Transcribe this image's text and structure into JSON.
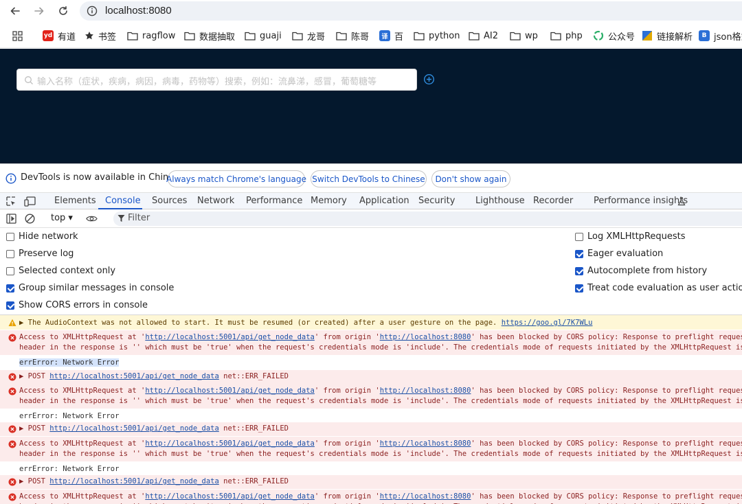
{
  "browser": {
    "url": "localhost:8080",
    "bookmarks": [
      {
        "label": "有道",
        "icon": "youdao-icon",
        "badge": "yd",
        "color": "#e2231a"
      },
      {
        "label": "书签",
        "icon": "star-icon"
      },
      {
        "label": "ragflow",
        "icon": "folder-icon"
      },
      {
        "label": "数据抽取",
        "icon": "folder-icon"
      },
      {
        "label": "guaji",
        "icon": "folder-icon"
      },
      {
        "label": "龙哥",
        "icon": "folder-icon"
      },
      {
        "label": "陈哥",
        "icon": "folder-icon"
      },
      {
        "label": "百",
        "icon": "translate-icon",
        "badge": "译",
        "color": "#2b6fd6"
      },
      {
        "label": "python",
        "icon": "folder-icon"
      },
      {
        "label": "AI2",
        "icon": "folder-icon"
      },
      {
        "label": "wp",
        "icon": "folder-icon"
      },
      {
        "label": "php",
        "icon": "folder-icon"
      },
      {
        "label": "公众号",
        "icon": "wechat-mp-icon",
        "color": "#2aae67"
      },
      {
        "label": "链接解析",
        "icon": "link-parse-icon",
        "color": "#e0a800"
      },
      {
        "label": "json格式",
        "icon": "json-icon",
        "badge": "B",
        "color": "#2b6fd6"
      }
    ]
  },
  "app": {
    "search_placeholder": "输入名称（症状，疾病，病因，病毒，药物等）搜索，例如：流鼻涕，感冒，葡萄糖等",
    "background": "#04182d"
  },
  "devtools": {
    "infobar": {
      "text": "DevTools is now available in Chinese!",
      "buttons": [
        "Always match Chrome's language",
        "Switch DevTools to Chinese",
        "Don't show again"
      ]
    },
    "tabs": [
      "Elements",
      "Console",
      "Sources",
      "Network",
      "Performance",
      "Memory",
      "Application",
      "Security",
      "Lighthouse",
      "Recorder",
      "Performance insights"
    ],
    "active_tab": "Console",
    "toolbar": {
      "context": "top ▾",
      "filter": "Filter"
    },
    "settings_left": [
      {
        "label": "Hide network",
        "checked": false
      },
      {
        "label": "Preserve log",
        "checked": false
      },
      {
        "label": "Selected context only",
        "checked": false
      },
      {
        "label": "Group similar messages in console",
        "checked": true
      },
      {
        "label": "Show CORS errors in console",
        "checked": true
      }
    ],
    "settings_right": [
      {
        "label": "Log XMLHttpRequests",
        "checked": false
      },
      {
        "label": "Eager evaluation",
        "checked": true
      },
      {
        "label": "Autocomplete from history",
        "checked": true
      },
      {
        "label": "Treat code evaluation as user action",
        "checked": true
      }
    ],
    "console": {
      "warning": {
        "text": "▶ The AudioContext was not allowed to start. It must be resumed (or created) after a user gesture on the page.",
        "link": "https://goo.gl/7K7WLu"
      },
      "cors_prefix": "Access to XMLHttpRequest at '",
      "cors_url": "http://localhost:5001/api/get_node_data",
      "cors_mid": "' from origin '",
      "cors_origin": "http://localhost:8080",
      "cors_suffix": "' has been blocked by CORS policy: Response to preflight request doesn't pass",
      "cors_line2": "header in the response is '' which must be 'true' when the request's credentials mode is 'include'. The credentials mode of requests initiated by the XMLHttpRequest is controlled by",
      "err_text": "errError: Network Error",
      "post_prefix": "▶ POST",
      "post_url": "http://localhost:5001/api/get_node_data",
      "post_suffix": "net::ERR_FAILED",
      "colors": {
        "warning_bg": "#fef7d6",
        "error_bg": "#fcebeb",
        "error_icon": "#d93025",
        "warning_icon": "#e8a200",
        "accent": "#1a56c8"
      }
    }
  }
}
